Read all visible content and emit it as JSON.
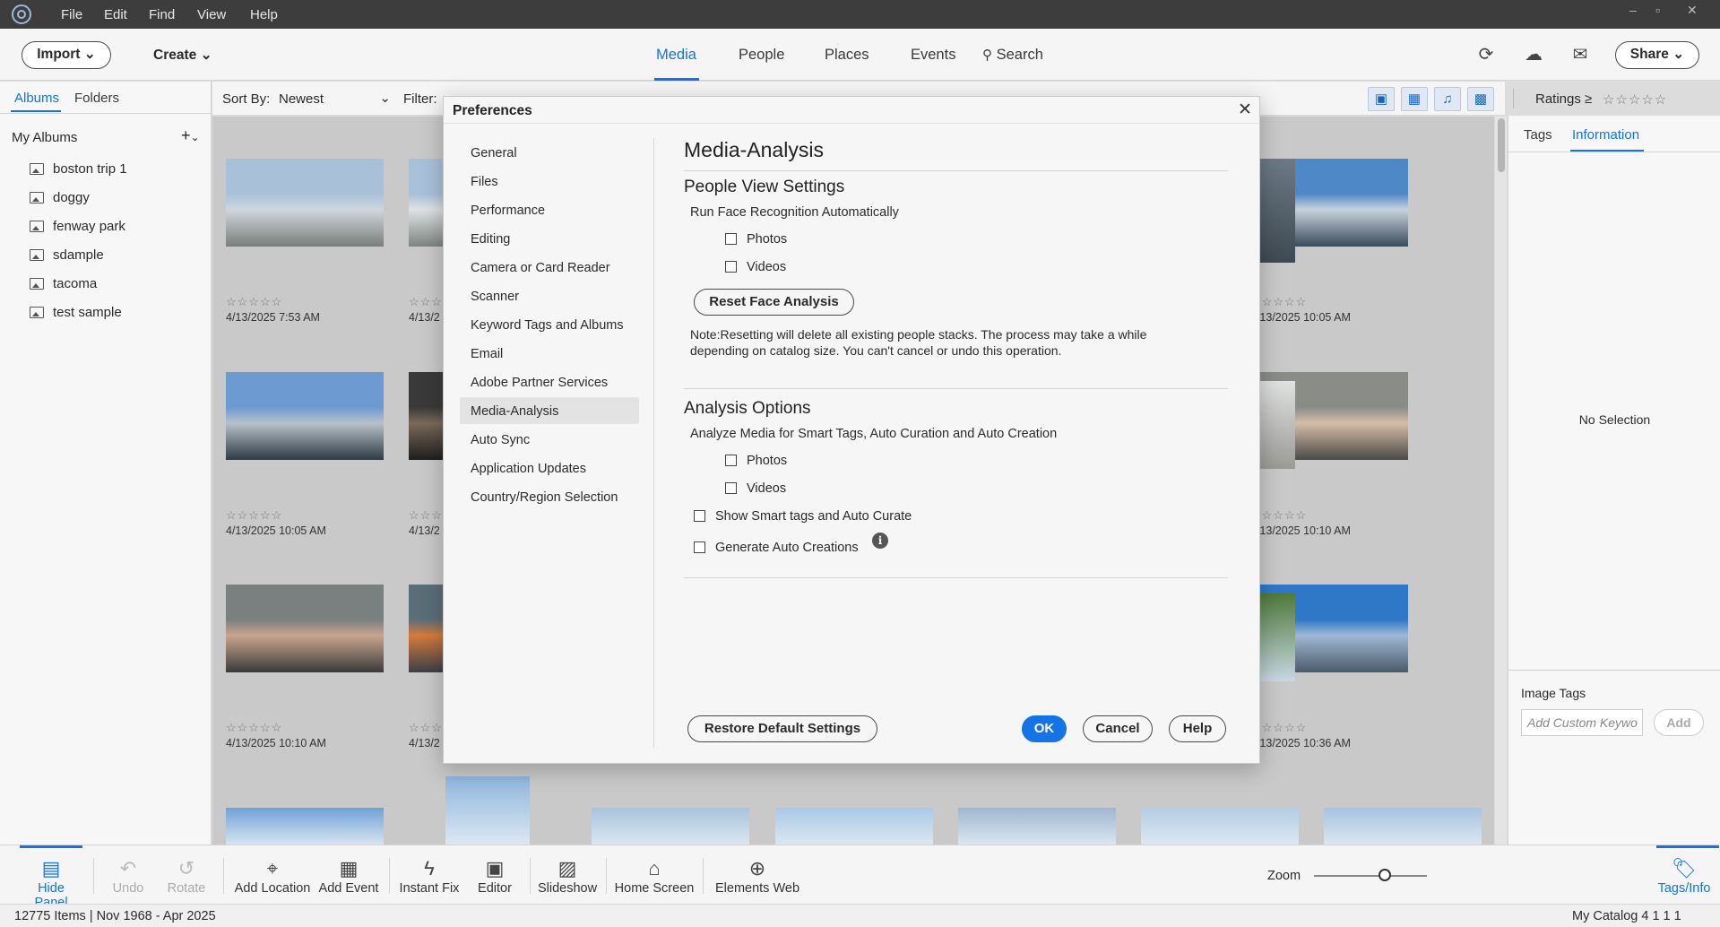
{
  "menubar": {
    "items": [
      "File",
      "Edit",
      "Find",
      "View",
      "Help"
    ],
    "window_controls": [
      "–",
      "▫",
      "✕"
    ]
  },
  "toolbar": {
    "import_label": "Import",
    "create_label": "Create",
    "tabs": [
      "Media",
      "People",
      "Places",
      "Events",
      "Search"
    ],
    "active_tab": "Media",
    "share_label": "Share"
  },
  "left_panel": {
    "tabs": [
      "Albums",
      "Folders"
    ],
    "section_title": "My Albums",
    "albums": [
      "boston trip 1",
      "doggy",
      "fenway park",
      "sdample",
      "tacoma",
      "test sample"
    ]
  },
  "sort_bar": {
    "sort_label": "Sort By:",
    "sort_value": "Newest",
    "filter_label": "Filter:",
    "ratings_label": "Ratings",
    "ratings_operator": "≥",
    "ratings_stars": "☆☆☆☆☆"
  },
  "grid": {
    "stars": "☆☆☆☆☆",
    "thumbnails": [
      {
        "date": "4/13/2025 7:53 AM",
        "colors": [
          "#a9c1d8",
          "#cfd6dc",
          "#7b7f7a"
        ]
      },
      {
        "date": "4/13/2",
        "colors": [
          "#a9c1d8",
          "#dfe2e4",
          "#7c8480"
        ]
      },
      {
        "date": "4/13/2025 10:05 AM",
        "colors": [
          "#4f88c6",
          "#c8d2dc",
          "#3a4a5a"
        ]
      },
      {
        "date": "4/13/2025 10:05 AM",
        "colors": [
          "#6c9ad1",
          "#b7c1c9",
          "#2e3b44"
        ]
      },
      {
        "date": "4/13/2",
        "colors": [
          "#3a3a3a",
          "#7a6a5a",
          "#1e1e1e"
        ]
      },
      {
        "date": "4/13/2025 10:10 AM",
        "colors": [
          "#8a8c88",
          "#d4bca8",
          "#4a4a48"
        ]
      },
      {
        "date": "4/13/2025 10:10 AM",
        "colors": [
          "#7a7f80",
          "#c7a58e",
          "#3a3a3a"
        ]
      },
      {
        "date": "4/13/2",
        "colors": [
          "#5b6e78",
          "#d67a3c",
          "#3a4048"
        ]
      },
      {
        "date": "4/13/2025 10:36 AM",
        "colors": [
          "#2f78c8",
          "#9fb8d4",
          "#4b5a68"
        ]
      }
    ],
    "edge_thumbs": [
      {
        "colors": [
          "#6d7a86",
          "#3e4a52"
        ]
      },
      {
        "colors": [
          "#e0e2e1",
          "#9a9a96"
        ]
      },
      {
        "colors": [
          "#4f7a3a",
          "#c9d7e4"
        ]
      }
    ],
    "bottom_row_colors": [
      "#6fa1d6",
      "#8fb6de",
      "#a8c4dc",
      "#a9c8e6",
      "#9fb7cf",
      "#b4cde4",
      "#a6c3e0"
    ]
  },
  "right_panel": {
    "tabs": [
      "Tags",
      "Information"
    ],
    "no_selection": "No Selection",
    "image_tags_label": "Image Tags",
    "tag_placeholder": "Add Custom Keywo",
    "add_label": "Add"
  },
  "taskbar": {
    "items": [
      {
        "label": "Hide Panel",
        "icon": "▤"
      },
      {
        "label": "Undo",
        "icon": "↶"
      },
      {
        "label": "Rotate",
        "icon": "↺"
      },
      {
        "label": "Add Location",
        "icon": "⌖"
      },
      {
        "label": "Add Event",
        "icon": "▦"
      },
      {
        "label": "Instant Fix",
        "icon": "ϟ"
      },
      {
        "label": "Editor",
        "icon": "▣"
      },
      {
        "label": "Slideshow",
        "icon": "▨"
      },
      {
        "label": "Home Screen",
        "icon": "⌂"
      },
      {
        "label": "Elements Web",
        "icon": "⊕"
      }
    ],
    "zoom_label": "Zoom",
    "zoom_level": 0.6,
    "tags_info_label": "Tags/Info"
  },
  "status_bar": {
    "left": "12775 Items | Nov 1968 - Apr 2025",
    "right": "My Catalog 4 1 1 1"
  },
  "preferences_dialog": {
    "title": "Preferences",
    "nav_items": [
      "General",
      "Files",
      "Performance",
      "Editing",
      "Camera or Card Reader",
      "Scanner",
      "Keyword Tags and Albums",
      "Email",
      "Adobe Partner Services",
      "Media-Analysis",
      "Auto Sync",
      "Application Updates",
      "Country/Region Selection"
    ],
    "active_nav": "Media-Analysis",
    "heading": "Media-Analysis",
    "people_section": {
      "title": "People View Settings",
      "subtitle": "Run Face Recognition Automatically",
      "photos_label": "Photos",
      "photos_checked": false,
      "videos_label": "Videos",
      "videos_checked": false,
      "reset_button": "Reset Face Analysis",
      "note": "Note:Resetting will delete all existing people stacks. The process may take a while depending on catalog size. You can't cancel or undo this operation."
    },
    "analysis_section": {
      "title": "Analysis Options",
      "subtitle": "Analyze Media for Smart Tags, Auto Curation and Auto Creation",
      "photos_label": "Photos",
      "photos_checked": false,
      "videos_label": "Videos",
      "videos_checked": false,
      "smart_tags_label": "Show Smart tags and Auto Curate",
      "smart_tags_checked": false,
      "auto_creations_label": "Generate Auto Creations",
      "auto_creations_checked": false
    },
    "restore_button": "Restore Default Settings",
    "ok_button": "OK",
    "cancel_button": "Cancel",
    "help_button": "Help"
  }
}
